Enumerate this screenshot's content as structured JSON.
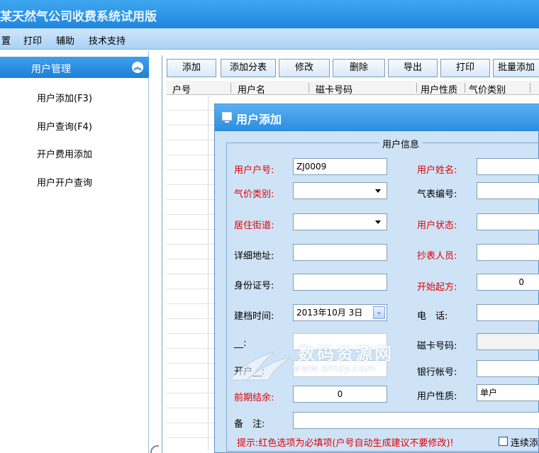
{
  "window": {
    "title": "某天然气公司收费系统试用版"
  },
  "menu": [
    "置",
    "打印",
    "辅助",
    "技术支持"
  ],
  "sidebar": {
    "group": "用户管理",
    "items": [
      "用户添加(F3)",
      "用户查询(F4)",
      "开户费用添加",
      "用户开户查询"
    ]
  },
  "toolbar": [
    "添加",
    "添加分表",
    "修改",
    "删除",
    "导出",
    "打印",
    "批量添加"
  ],
  "grid": {
    "columns": [
      "户号",
      "用户名",
      "磁卡号码",
      "用户性质",
      "气价类别"
    ]
  },
  "dialog": {
    "title": "用户添加",
    "legend": "用户信息",
    "fields": {
      "user_no_label": "用户户号:",
      "user_no_value": "ZJ0009",
      "user_name_label": "用户姓名:",
      "price_type_label": "气价类别:",
      "meter_no_label": "气表编号:",
      "street_label": "居住街道:",
      "status_label": "用户状态:",
      "address_label": "详细地址:",
      "reader_label": "抄表人员:",
      "id_label": "身份证号:",
      "start_label": "开始起方:",
      "start_value": "0",
      "created_label": "建档时间:",
      "created_value": "2013年10月 3日",
      "phone_label": "电　话:",
      "row7_left_label": "__:",
      "card_label": "磁卡号码:",
      "row8_left_label": "开户__:",
      "bank_label": "银行帐号:",
      "prev_balance_label": "前期结余:",
      "prev_balance_value": "0",
      "nature_label": "用户性质:",
      "nature_value": "单户",
      "remark_label": "备　注:"
    },
    "hint": "提示:红色选项为必填项(户号自动生成建议不要修改)!",
    "continue_label": "连续添"
  },
  "watermark": {
    "text": "数码资源网",
    "url": "www.smzy.com"
  },
  "colors": {
    "title_bar": "#2a8ce0",
    "required_label": "#e00000",
    "dialog_bg": "#cfe3f7"
  }
}
